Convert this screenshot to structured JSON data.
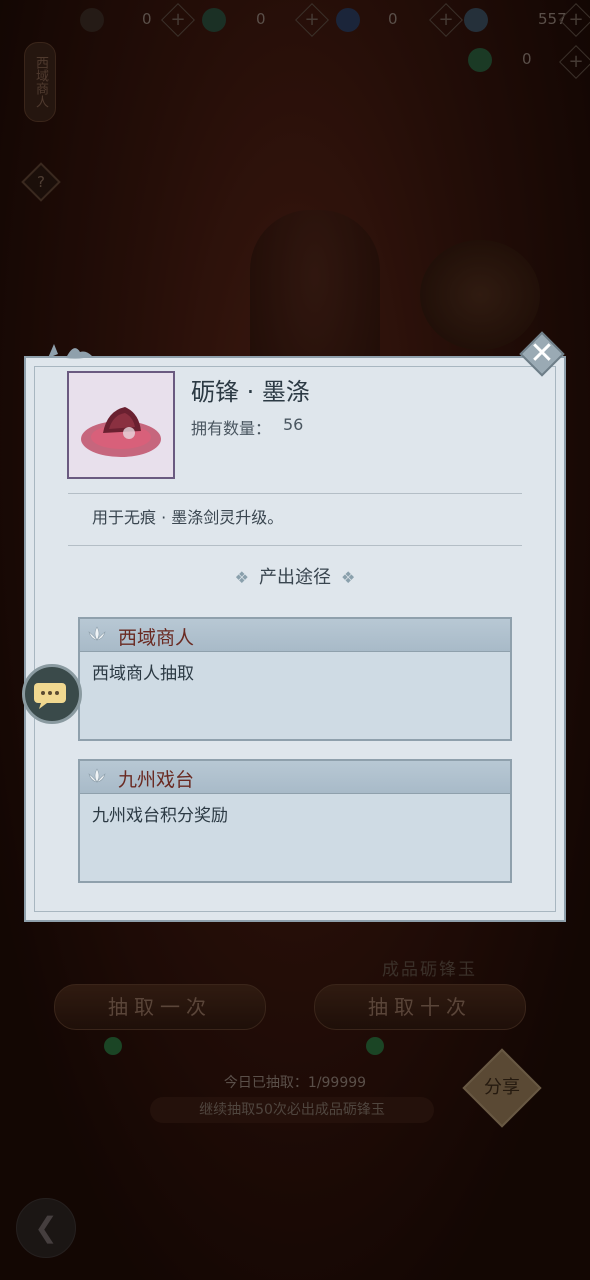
{
  "currencies": [
    {
      "icon": "sword-icon",
      "value": "0"
    },
    {
      "icon": "jade-coin-icon",
      "value": "0"
    },
    {
      "icon": "blue-crystal-icon",
      "value": "0"
    },
    {
      "icon": "feather-icon",
      "value": "557"
    },
    {
      "icon": "green-jade-icon",
      "value": "0"
    }
  ],
  "left_banner": "西域商人",
  "help_glyph": "?",
  "background": {
    "item_tag": "成品砺锋玉",
    "pull_once": "抽取一次",
    "pull_ten": "抽取十次",
    "today_label": "今日已抽取：1/99999",
    "ticker": "继续抽取50次必出成品砺锋玉",
    "share": "分享"
  },
  "modal": {
    "item_name": "砺锋 · 墨涤",
    "owned_label": "拥有数量：",
    "owned_count": "56",
    "description": "用于无痕 · 墨涤剑灵升级。",
    "source_title": "产出途径",
    "sources": [
      {
        "name": "西域商人",
        "detail": "西域商人抽取"
      },
      {
        "name": "九州戏台",
        "detail": "九州戏台积分奖励"
      }
    ]
  },
  "colors": {
    "modal_bg": "#dfe6ec",
    "source_name": "#6a2a22",
    "card_bg": "#cfdbe4"
  }
}
